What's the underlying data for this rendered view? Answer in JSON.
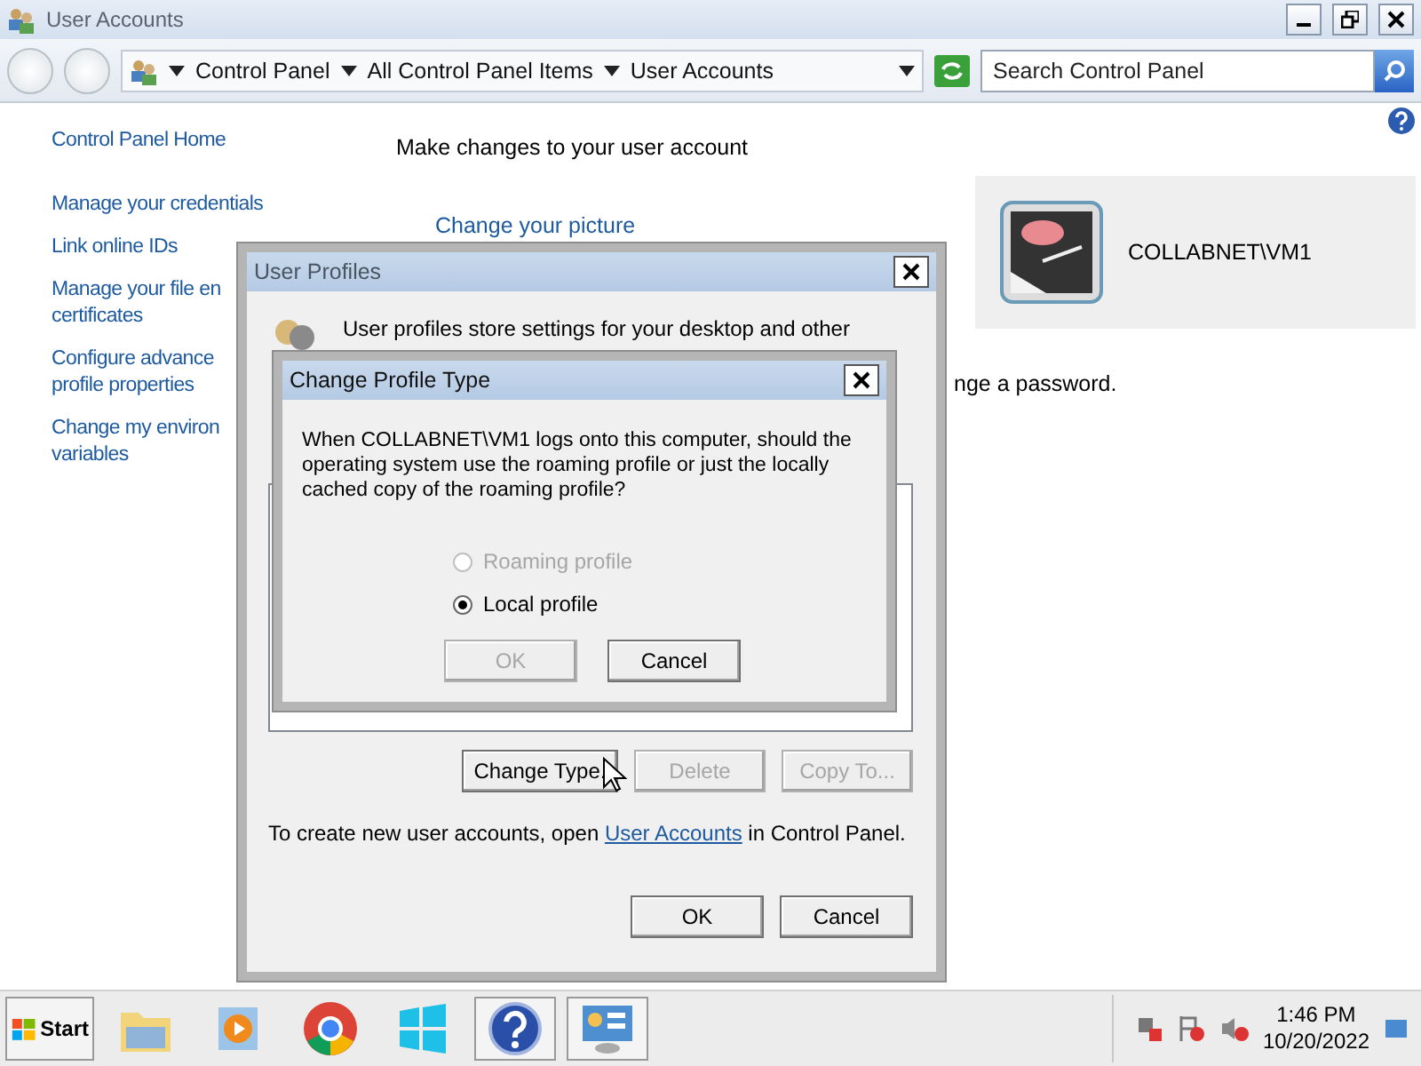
{
  "window": {
    "title": "User Accounts"
  },
  "address_bar": {
    "breadcrumb": [
      "Control Panel",
      "All Control Panel Items",
      "User Accounts"
    ]
  },
  "search": {
    "placeholder": "Search Control Panel"
  },
  "sidebar": {
    "links": [
      {
        "lines": [
          "Control Panel Home"
        ]
      },
      {
        "lines": [
          "Manage your credentials"
        ]
      },
      {
        "lines": [
          "Link online IDs"
        ]
      },
      {
        "lines": [
          "Manage your file en",
          "certificates"
        ]
      },
      {
        "lines": [
          "Configure advance",
          "profile properties"
        ]
      },
      {
        "lines": [
          "Change my environ",
          "variables"
        ]
      }
    ]
  },
  "main": {
    "heading": "Make changes to your user account",
    "links": [
      "Change your picture"
    ],
    "partial_text": "nge a password."
  },
  "user_card": {
    "name": "COLLABNET\\VM1"
  },
  "user_profiles": {
    "title": "User Profiles",
    "description": "User profiles store settings for your desktop and other",
    "buttons": [
      {
        "label": "Change Type.",
        "disabled": false
      },
      {
        "label": "Delete",
        "disabled": true
      },
      {
        "label": "Copy To...",
        "disabled": true
      }
    ],
    "note": {
      "before": "To create new user accounts, open ",
      "link": "User Accounts",
      "after": " in Control Panel."
    },
    "footer_buttons": [
      "OK",
      "Cancel"
    ]
  },
  "change_profile_type": {
    "title": "Change Profile Type",
    "message": "When COLLABNET\\VM1 logs onto this computer, should the operating system use the roaming profile or just the locally cached copy of the roaming profile?",
    "options": [
      {
        "label": "Roaming profile",
        "selected": false,
        "disabled": true
      },
      {
        "label": "Local profile",
        "selected": true,
        "disabled": false
      }
    ],
    "buttons": [
      {
        "label": "OK",
        "disabled": true
      },
      {
        "label": "Cancel",
        "disabled": false
      }
    ]
  },
  "taskbar": {
    "start": "Start",
    "apps": [
      {
        "kind": "folder"
      },
      {
        "kind": "media"
      },
      {
        "kind": "browser"
      },
      {
        "kind": "tiles"
      },
      {
        "kind": "help"
      },
      {
        "kind": "panel"
      }
    ],
    "time": "1:46 PM",
    "date": "10/20/2022"
  }
}
